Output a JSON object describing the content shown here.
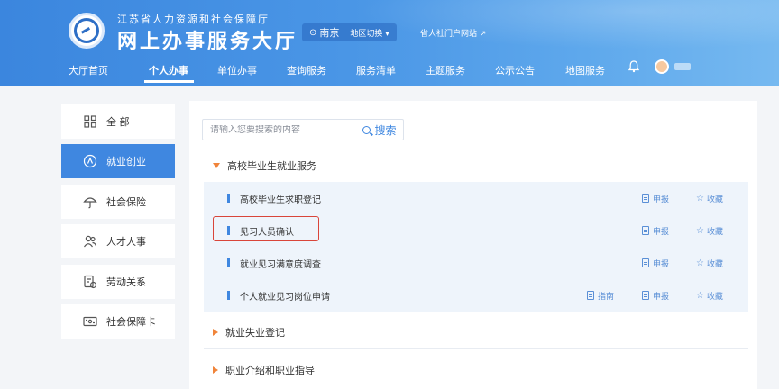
{
  "header": {
    "org_name": "江苏省人力资源和社会保障厅",
    "site_title": "网上办事服务大厅",
    "city": "南京",
    "region_switch": "地区切换",
    "portal_link": "省人社门户网站"
  },
  "nav": {
    "items": [
      {
        "label": "大厅首页"
      },
      {
        "label": "个人办事"
      },
      {
        "label": "单位办事"
      },
      {
        "label": "查询服务"
      },
      {
        "label": "服务清单"
      },
      {
        "label": "主题服务"
      },
      {
        "label": "公示公告"
      },
      {
        "label": "地图服务"
      }
    ],
    "active": "个人办事"
  },
  "sidebar": {
    "items": [
      {
        "label": "全 部",
        "icon": "grid-icon"
      },
      {
        "label": "就业创业",
        "icon": "briefcase-icon"
      },
      {
        "label": "社会保险",
        "icon": "umbrella-icon"
      },
      {
        "label": "人才人事",
        "icon": "people-icon"
      },
      {
        "label": "劳动关系",
        "icon": "contract-icon"
      },
      {
        "label": "社会保障卡",
        "icon": "card-icon"
      }
    ],
    "active": "就业创业"
  },
  "search": {
    "placeholder": "请输入您要搜索的内容",
    "button_label": "搜索"
  },
  "categories": {
    "expanded": {
      "label": "高校毕业生就业服务"
    },
    "collapsed": [
      {
        "label": "就业失业登记"
      },
      {
        "label": "职业介绍和职业指导"
      }
    ]
  },
  "services": [
    {
      "label": "高校毕业生求职登记",
      "apply": "申报",
      "favorite": "收藏"
    },
    {
      "label": "见习人员确认",
      "apply": "申报",
      "favorite": "收藏"
    },
    {
      "label": "就业见习满意度调查",
      "apply": "申报",
      "favorite": "收藏"
    },
    {
      "label": "个人就业见习岗位申请",
      "guide": "指南",
      "apply": "申报",
      "favorite": "收藏"
    }
  ],
  "colors": {
    "accent": "#3f87e0",
    "highlight": "#d9453a",
    "caret": "#f0843a"
  }
}
